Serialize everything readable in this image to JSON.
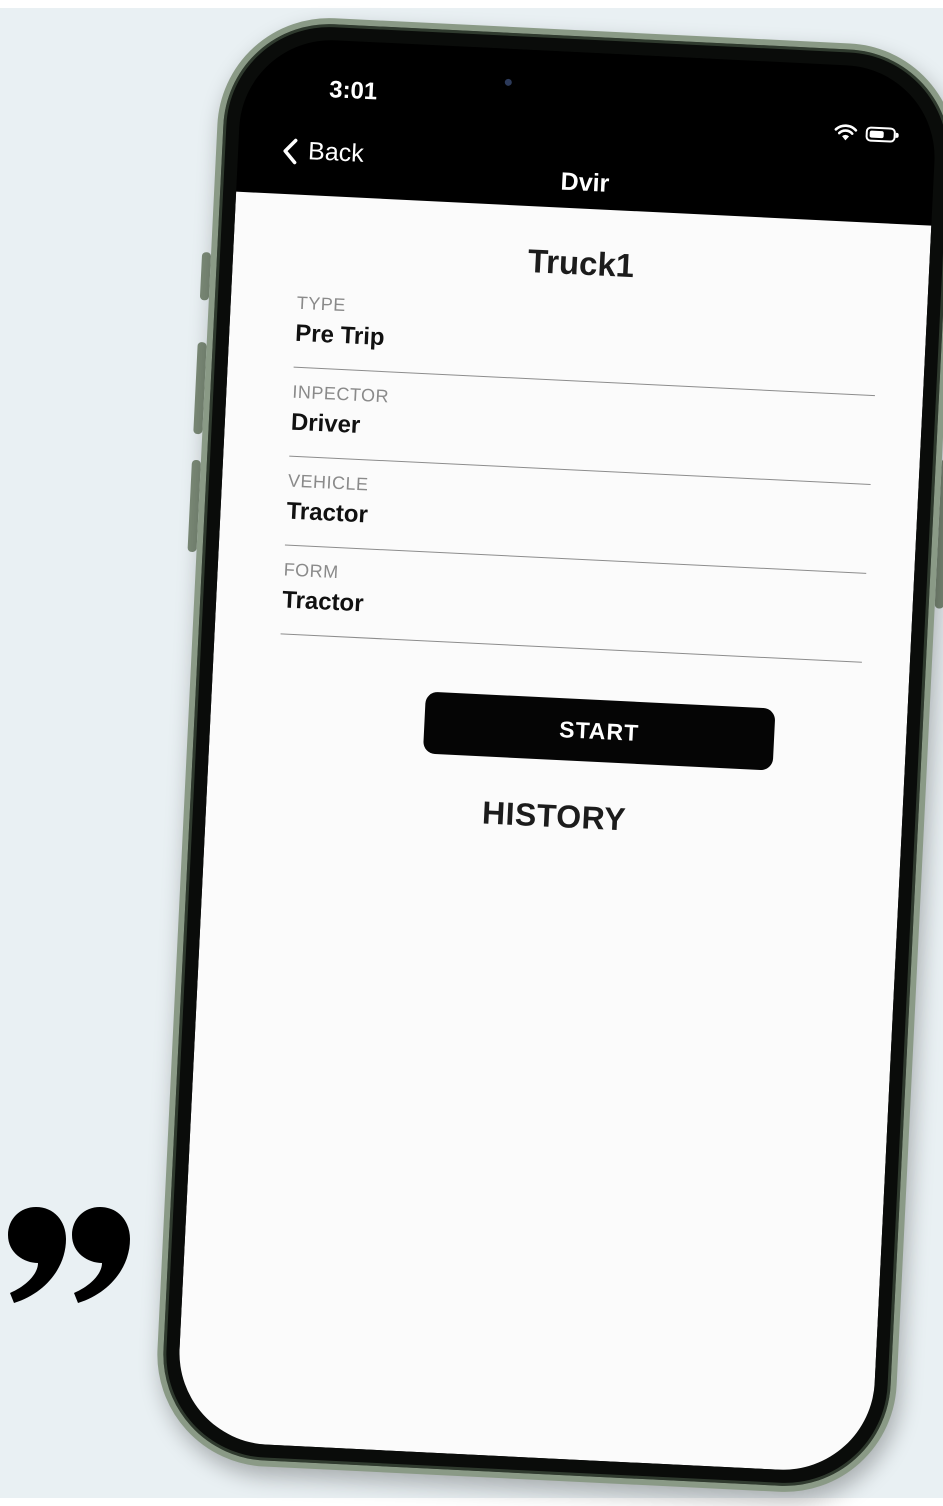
{
  "status_bar": {
    "time": "3:01",
    "wifi_icon": "wifi-icon",
    "battery_icon": "battery-icon",
    "battery_level": 0.65
  },
  "nav": {
    "back_label": "Back",
    "back_icon": "chevron-left-icon",
    "title": "Dvir"
  },
  "vehicle": {
    "title": "Truck1"
  },
  "fields": [
    {
      "label": "TYPE",
      "value": "Pre Trip"
    },
    {
      "label": "INPECTOR",
      "value": "Driver"
    },
    {
      "label": "VEHICLE",
      "value": "Tractor"
    },
    {
      "label": "FORM",
      "value": "Tractor"
    }
  ],
  "actions": {
    "start_label": "START"
  },
  "history": {
    "heading": "HISTORY"
  },
  "decor": {
    "quote_icon": "closing-quote-icon"
  },
  "colors": {
    "nav_background": "#000000",
    "button_background": "#050505",
    "content_background": "#fbfbfb",
    "phone_frame": "#8a9a86"
  }
}
